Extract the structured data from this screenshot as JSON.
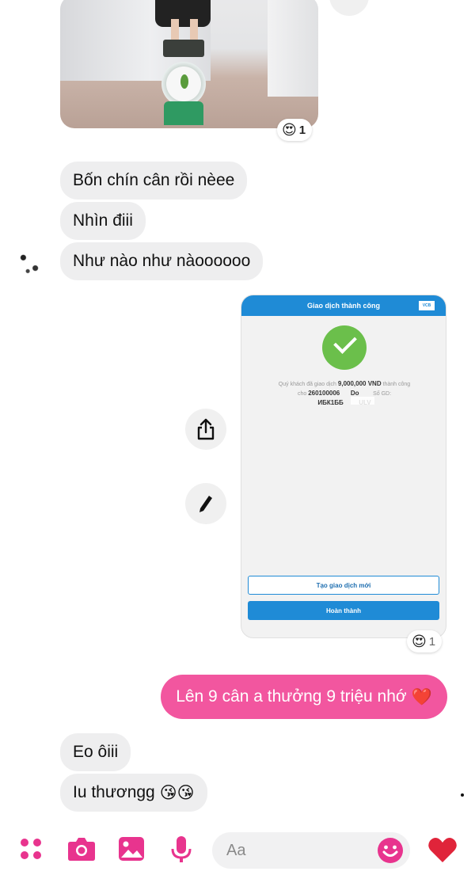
{
  "messages": {
    "photo_reaction": {
      "emoji": "😍",
      "count": "1"
    },
    "incoming": [
      {
        "text": "Bốn chín cân rồi nèee"
      },
      {
        "text": "Nhìn điii"
      },
      {
        "text": "Như nào như nàoooooo"
      }
    ],
    "receipt": {
      "header": "Giao dịch thành công",
      "line1_prefix": "Quý khách đã giao dịch",
      "amount": "9,000,000 VND",
      "line1_suffix": "thành công",
      "line2_prefix": "cho",
      "account": "260100006",
      "line2_mid": "Do",
      "line2_suffix": "Số GD:",
      "ref_start": "ИБК1ББ",
      "ref_end": "ULV",
      "new_tx_button": "Tạo giao dịch mới",
      "done_button": "Hoàn thành",
      "reaction": {
        "emoji": "😍",
        "count": "1"
      }
    },
    "outgoing": {
      "text": "Lên 9 cân a thưởng 9 triệu nhớ",
      "emoji": "❤️"
    },
    "incoming_2": [
      {
        "text": "Eo ôiii"
      },
      {
        "text": "Iu thươngg",
        "emoji": "😘😘"
      }
    ]
  },
  "composer": {
    "placeholder": "Aa",
    "like_emoji": "❤️",
    "emoji_button": "☺"
  },
  "colors": {
    "accent": "#e8348e",
    "outgoing_bubble": "#f2569f",
    "incoming_bubble": "#eeeeef",
    "bank_blue": "#1f8bd6",
    "success_green": "#6bbf4b"
  }
}
